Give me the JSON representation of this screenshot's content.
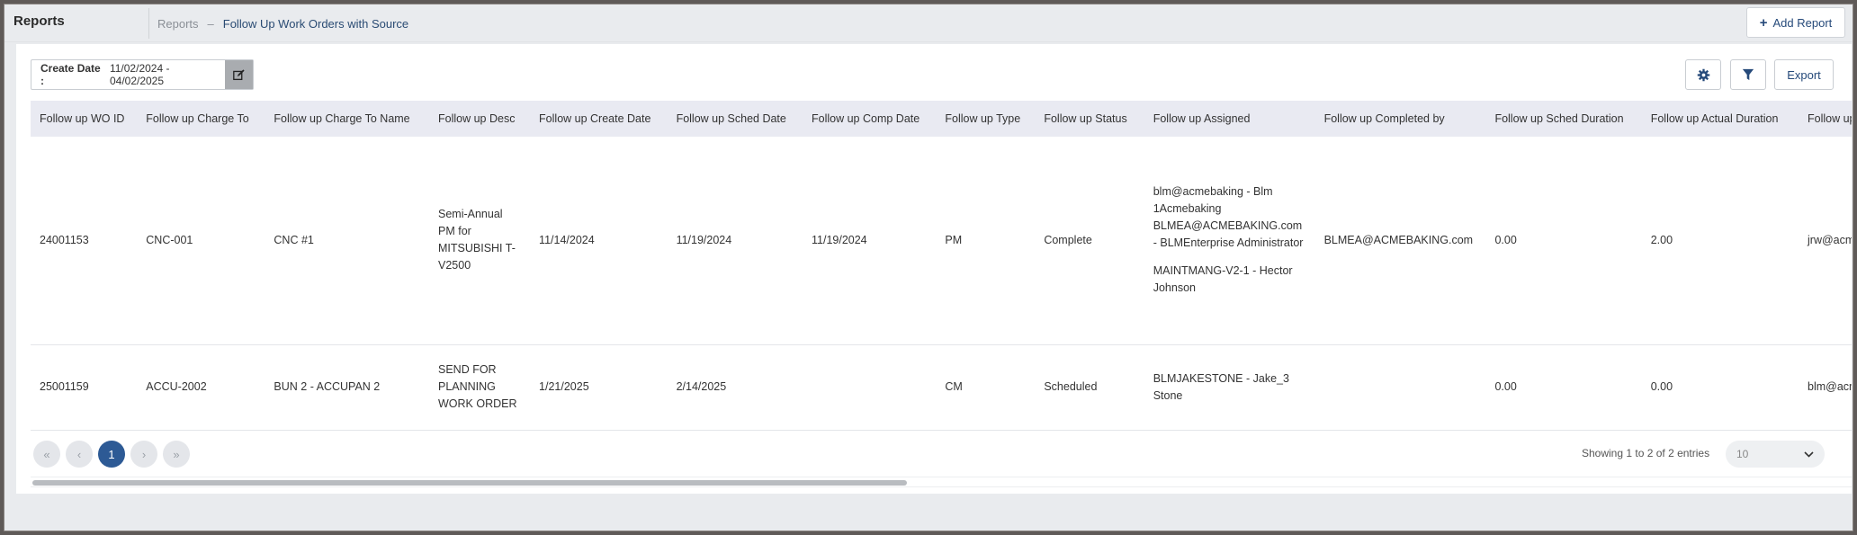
{
  "header": {
    "title": "Reports",
    "breadcrumb_root": "Reports",
    "breadcrumb_sep": "–",
    "breadcrumb_current": "Follow Up Work Orders with Source",
    "add_report_label": "Add Report"
  },
  "toolbar": {
    "date_label": "Create Date :",
    "date_value": "11/02/2024 - 04/02/2025",
    "export_label": "Export"
  },
  "table": {
    "columns": [
      "Follow up WO ID",
      "Follow up Charge To",
      "Follow up Charge To Name",
      "Follow up Desc",
      "Follow up Create Date",
      "Follow up Sched Date",
      "Follow up Comp Date",
      "Follow up Type",
      "Follow up Status",
      "Follow up Assigned",
      "Follow up Completed by",
      "Follow up Sched Duration",
      "Follow up Actual Duration",
      "Follow up Created"
    ],
    "rows": [
      {
        "wo_id": "24001153",
        "charge_to": "CNC-001",
        "charge_to_name": "CNC #1",
        "desc": "Semi-Annual PM for MITSUBISHI T-V2500",
        "create_date": "11/14/2024",
        "sched_date": "11/19/2024",
        "comp_date": "11/19/2024",
        "type": "PM",
        "status": "Complete",
        "assigned_1": "blm@acmebaking - Blm 1Acmebaking BLMEA@ACMEBAKING.com - BLMEnterprise Administrator",
        "assigned_2": "MAINTMANG-V2-1 - Hector Johnson",
        "completed_by": "BLMEA@ACMEBAKING.com",
        "sched_duration": "0.00",
        "actual_duration": "2.00",
        "created": "jrw@acmebaking"
      },
      {
        "wo_id": "25001159",
        "charge_to": "ACCU-2002",
        "charge_to_name": "BUN 2 - ACCUPAN 2",
        "desc": "SEND FOR PLANNING WORK ORDER",
        "create_date": "1/21/2025",
        "sched_date": "2/14/2025",
        "comp_date": "",
        "type": "CM",
        "status": "Scheduled",
        "assigned_1": "BLMJAKESTONE - Jake_3 Stone",
        "assigned_2": "",
        "completed_by": "",
        "sched_duration": "0.00",
        "actual_duration": "0.00",
        "created": "blm@acmebaking"
      }
    ]
  },
  "pagination": {
    "current_page": "1",
    "showing_text": "Showing 1 to 2 of 2 entries",
    "page_size": "10"
  },
  "colors": {
    "accent": "#2d5a95",
    "link": "#264a7a",
    "header_bg": "#e9eaf2"
  }
}
